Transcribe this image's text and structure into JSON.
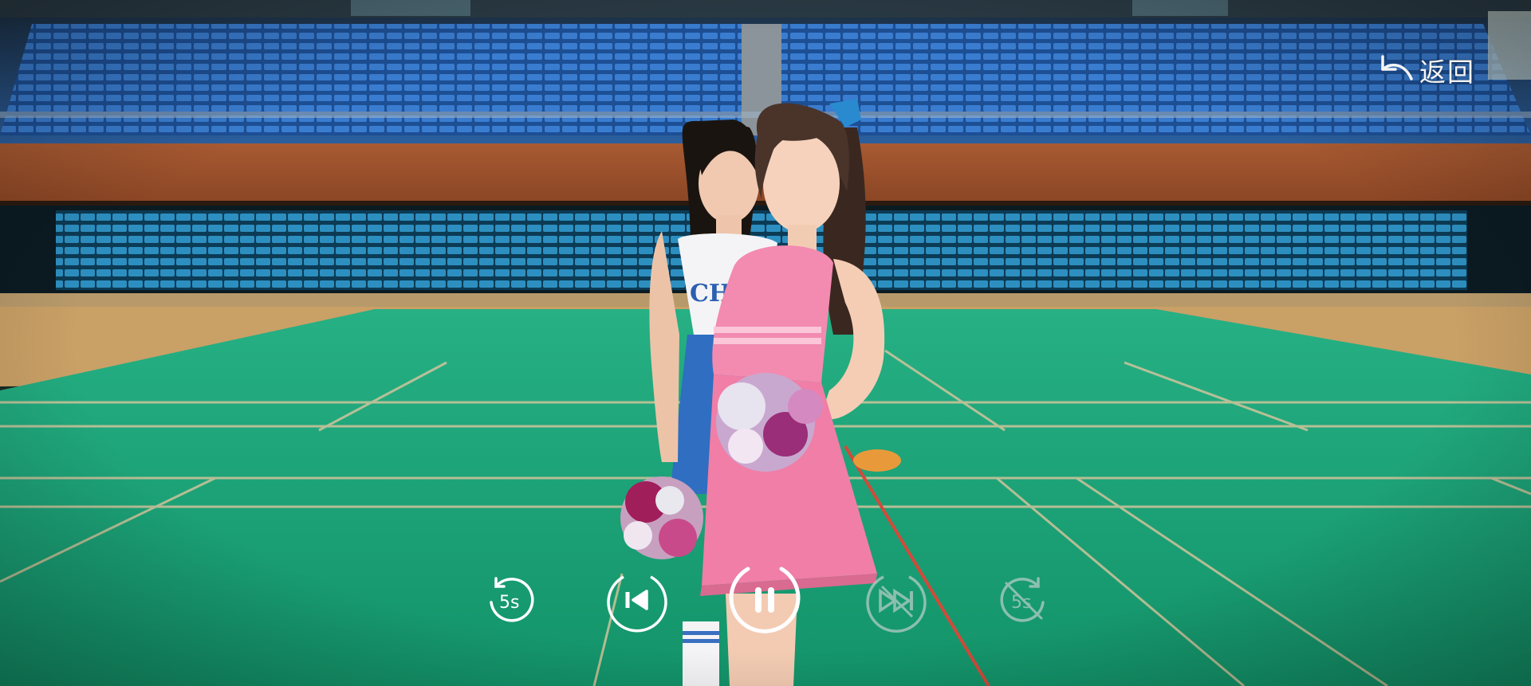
{
  "header": {
    "back_label": "返回",
    "back_icon": "back-arrow-icon"
  },
  "player": {
    "state": "playing",
    "controls": [
      {
        "name": "rewind-5s-button",
        "icon": "rewind-icon",
        "label": "5s",
        "enabled": true
      },
      {
        "name": "previous-episode-button",
        "icon": "skip-previous-icon",
        "enabled": true
      },
      {
        "name": "pause-button",
        "icon": "pause-icon",
        "enabled": true
      },
      {
        "name": "next-episode-button",
        "icon": "skip-next-icon",
        "enabled": false
      },
      {
        "name": "forward-5s-button",
        "icon": "fast-forward-icon",
        "label": "5s",
        "enabled": false
      }
    ]
  },
  "colors": {
    "court_green": "#1ea57c",
    "seat_blue": "#2f6ec0",
    "control_white": "#ffffff",
    "control_disabled": "#d9d9d9"
  }
}
